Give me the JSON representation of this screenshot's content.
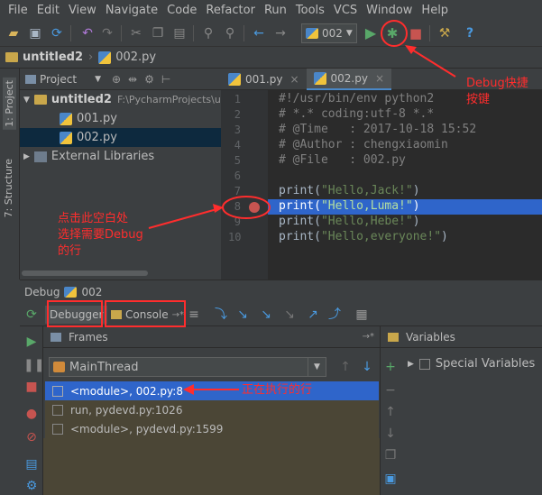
{
  "menu": [
    "File",
    "Edit",
    "View",
    "Navigate",
    "Code",
    "Refactor",
    "Run",
    "Tools",
    "VCS",
    "Window",
    "Help"
  ],
  "toolbar": {
    "run_config": "002"
  },
  "breadcrumb": {
    "project": "untitled2",
    "file": "002.py"
  },
  "sidebar": {
    "project_tab": "1: Project",
    "structure_tab": "7: Structure"
  },
  "project_panel": {
    "header": "Project",
    "root": "untitled2",
    "root_path": "F:\\PycharmProjects\\u",
    "files": [
      "001.py",
      "002.py"
    ],
    "external": "External Libraries"
  },
  "editor": {
    "tabs": [
      "001.py",
      "002.py"
    ],
    "line_numbers": [
      "1",
      "2",
      "3",
      "4",
      "5",
      "6",
      "7",
      "8",
      "9",
      "10"
    ],
    "lines": [
      {
        "parts": [
          {
            "t": "#!/usr/bin/env python2",
            "c": "cm"
          }
        ]
      },
      {
        "parts": [
          {
            "t": "# *.* coding:utf-8 *.*",
            "c": "cm"
          }
        ]
      },
      {
        "parts": [
          {
            "t": "# @Time   : 2017-10-18 15:52",
            "c": "cm"
          }
        ]
      },
      {
        "parts": [
          {
            "t": "# @Author : chengxiaomin",
            "c": "cm"
          }
        ]
      },
      {
        "parts": [
          {
            "t": "# @File   : 002.py",
            "c": "cm"
          }
        ]
      },
      {
        "parts": []
      },
      {
        "parts": [
          {
            "t": "print(",
            "c": "fn"
          },
          {
            "t": "\"Hello,Jack!\"",
            "c": "str"
          },
          {
            "t": ")",
            "c": "fn"
          }
        ]
      },
      {
        "parts": [
          {
            "t": "print(",
            "c": "fn"
          },
          {
            "t": "\"Hello,Luma!\"",
            "c": "str"
          },
          {
            "t": ")",
            "c": "fn"
          }
        ]
      },
      {
        "parts": [
          {
            "t": "print(",
            "c": "fn"
          },
          {
            "t": "\"Hello,Hebe!\"",
            "c": "str"
          },
          {
            "t": ")",
            "c": "fn"
          }
        ]
      },
      {
        "parts": [
          {
            "t": "print(",
            "c": "fn"
          },
          {
            "t": "\"Hello,everyone!\"",
            "c": "str"
          },
          {
            "t": ")",
            "c": "fn"
          }
        ]
      }
    ]
  },
  "debug": {
    "title": "Debug",
    "config": "002",
    "debugger_tab": "Debugger",
    "console_tab": "Console",
    "console_suffix": "→*",
    "frames_label": "Frames",
    "frames_suffix": "→*",
    "variables_label": "Variables",
    "thread": "MainThread",
    "frames": [
      "<module>, 002.py:8",
      "run, pydevd.py:1026",
      "<module>, pydevd.py:1599"
    ],
    "special_vars": "Special Variables"
  },
  "annotations": {
    "debug_btn": "Debug快捷\n按键",
    "click_hint": "点击此空白处\n选择需要Debug\n的行",
    "running_line": "正在执行的行"
  },
  "colors": {
    "accent_red": "#ff2d2d",
    "selection": "#2f65ca",
    "breakpoint": "#c75450"
  }
}
